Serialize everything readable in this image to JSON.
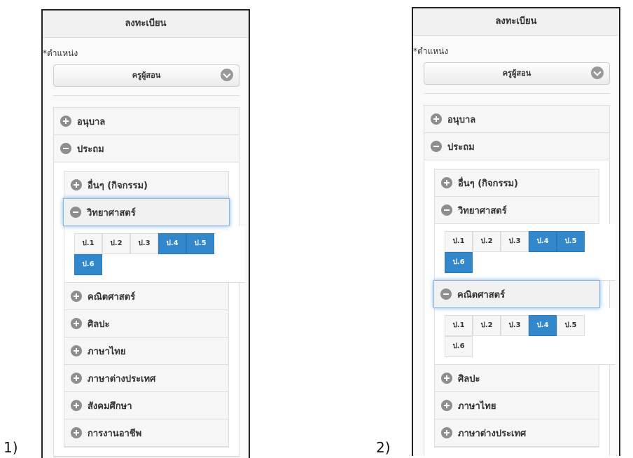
{
  "panels": [
    {
      "number_label": "1)",
      "title": "ลงทะเบียน",
      "position_label": "*ตำแหน่ง",
      "position_value": "ครูผู้สอน",
      "levels": [
        {
          "label": "อนุบาล",
          "state": "collapsed"
        },
        {
          "label": "ประถม",
          "state": "expanded"
        }
      ],
      "subjects": [
        {
          "label": "อื่นๆ (กิจกรรม)",
          "state": "collapsed"
        },
        {
          "label": "วิทยาศาสตร์",
          "state": "expanded",
          "active": true
        },
        {
          "label": "คณิตศาสตร์",
          "state": "collapsed"
        },
        {
          "label": "ศิลปะ",
          "state": "collapsed"
        },
        {
          "label": "ภาษาไทย",
          "state": "collapsed"
        },
        {
          "label": "ภาษาต่างประเทศ",
          "state": "collapsed"
        },
        {
          "label": "สังคมศึกษา",
          "state": "collapsed"
        },
        {
          "label": "การงานอาชีพ",
          "state": "collapsed"
        }
      ],
      "grade_groups": {
        "วิทยาศาสตร์": [
          {
            "label": "ป.1",
            "selected": false
          },
          {
            "label": "ป.2",
            "selected": false
          },
          {
            "label": "ป.3",
            "selected": false
          },
          {
            "label": "ป.4",
            "selected": true
          },
          {
            "label": "ป.5",
            "selected": true
          },
          {
            "label": "ป.6",
            "selected": true
          }
        ]
      }
    },
    {
      "number_label": "2)",
      "title": "ลงทะเบียน",
      "position_label": "*ตำแหน่ง",
      "position_value": "ครูผู้สอน",
      "levels": [
        {
          "label": "อนุบาล",
          "state": "collapsed"
        },
        {
          "label": "ประถม",
          "state": "expanded"
        }
      ],
      "subjects": [
        {
          "label": "อื่นๆ (กิจกรรม)",
          "state": "collapsed"
        },
        {
          "label": "วิทยาศาสตร์",
          "state": "expanded"
        },
        {
          "label": "คณิตศาสตร์",
          "state": "expanded",
          "active": true
        },
        {
          "label": "ศิลปะ",
          "state": "collapsed"
        },
        {
          "label": "ภาษาไทย",
          "state": "collapsed"
        },
        {
          "label": "ภาษาต่างประเทศ",
          "state": "collapsed"
        }
      ],
      "grade_groups": {
        "วิทยาศาสตร์": [
          {
            "label": "ป.1",
            "selected": false
          },
          {
            "label": "ป.2",
            "selected": false
          },
          {
            "label": "ป.3",
            "selected": false
          },
          {
            "label": "ป.4",
            "selected": true
          },
          {
            "label": "ป.5",
            "selected": true
          },
          {
            "label": "ป.6",
            "selected": true
          }
        ],
        "คณิตศาสตร์": [
          {
            "label": "ป.1",
            "selected": false
          },
          {
            "label": "ป.2",
            "selected": false
          },
          {
            "label": "ป.3",
            "selected": false
          },
          {
            "label": "ป.4",
            "selected": true
          },
          {
            "label": "ป.5",
            "selected": false
          },
          {
            "label": "ป.6",
            "selected": false
          }
        ]
      }
    }
  ]
}
